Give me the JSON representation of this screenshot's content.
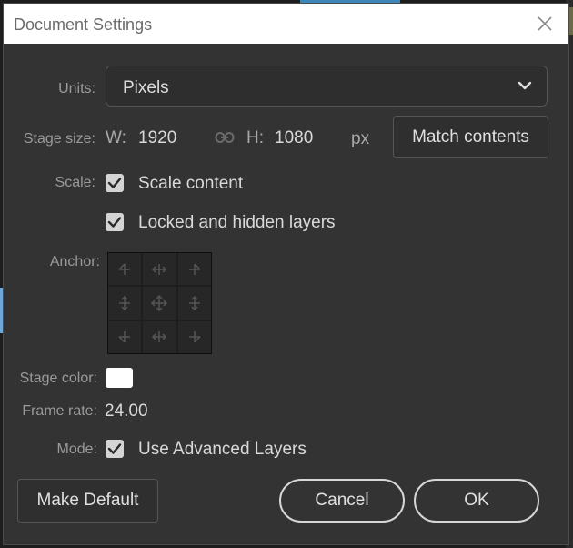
{
  "dialog": {
    "title": "Document Settings",
    "close_icon": "close-icon"
  },
  "units": {
    "label": "Units:",
    "value": "Pixels",
    "icon": "chevron-down-icon"
  },
  "stage_size": {
    "label": "Stage size:",
    "w_label": "W:",
    "w_value": "1920",
    "link_icon": "link-icon",
    "h_label": "H:",
    "h_value": "1080",
    "unit": "px",
    "match_button": "Match contents"
  },
  "scale": {
    "label": "Scale:",
    "scale_content": {
      "label": "Scale content",
      "checked": true
    },
    "locked_layers": {
      "label": "Locked and hidden layers",
      "checked": true
    }
  },
  "anchor": {
    "label": "Anchor:",
    "cells": [
      "top-left",
      "top-center",
      "top-right",
      "middle-left",
      "center",
      "middle-right",
      "bottom-left",
      "bottom-center",
      "bottom-right"
    ]
  },
  "stage_color": {
    "label": "Stage color:",
    "color": "#ffffff"
  },
  "frame_rate": {
    "label": "Frame rate:",
    "value": "24.00"
  },
  "mode": {
    "label": "Mode:",
    "advanced_layers": {
      "label": "Use Advanced Layers",
      "checked": true
    }
  },
  "buttons": {
    "make_default": "Make Default",
    "cancel": "Cancel",
    "ok": "OK"
  },
  "colors": {
    "dialog_bg": "#333333",
    "titlebar_bg": "#ffffff",
    "label": "#9a9a9a",
    "text": "#d9d9d9",
    "checkbox": "#d4d4d4"
  }
}
